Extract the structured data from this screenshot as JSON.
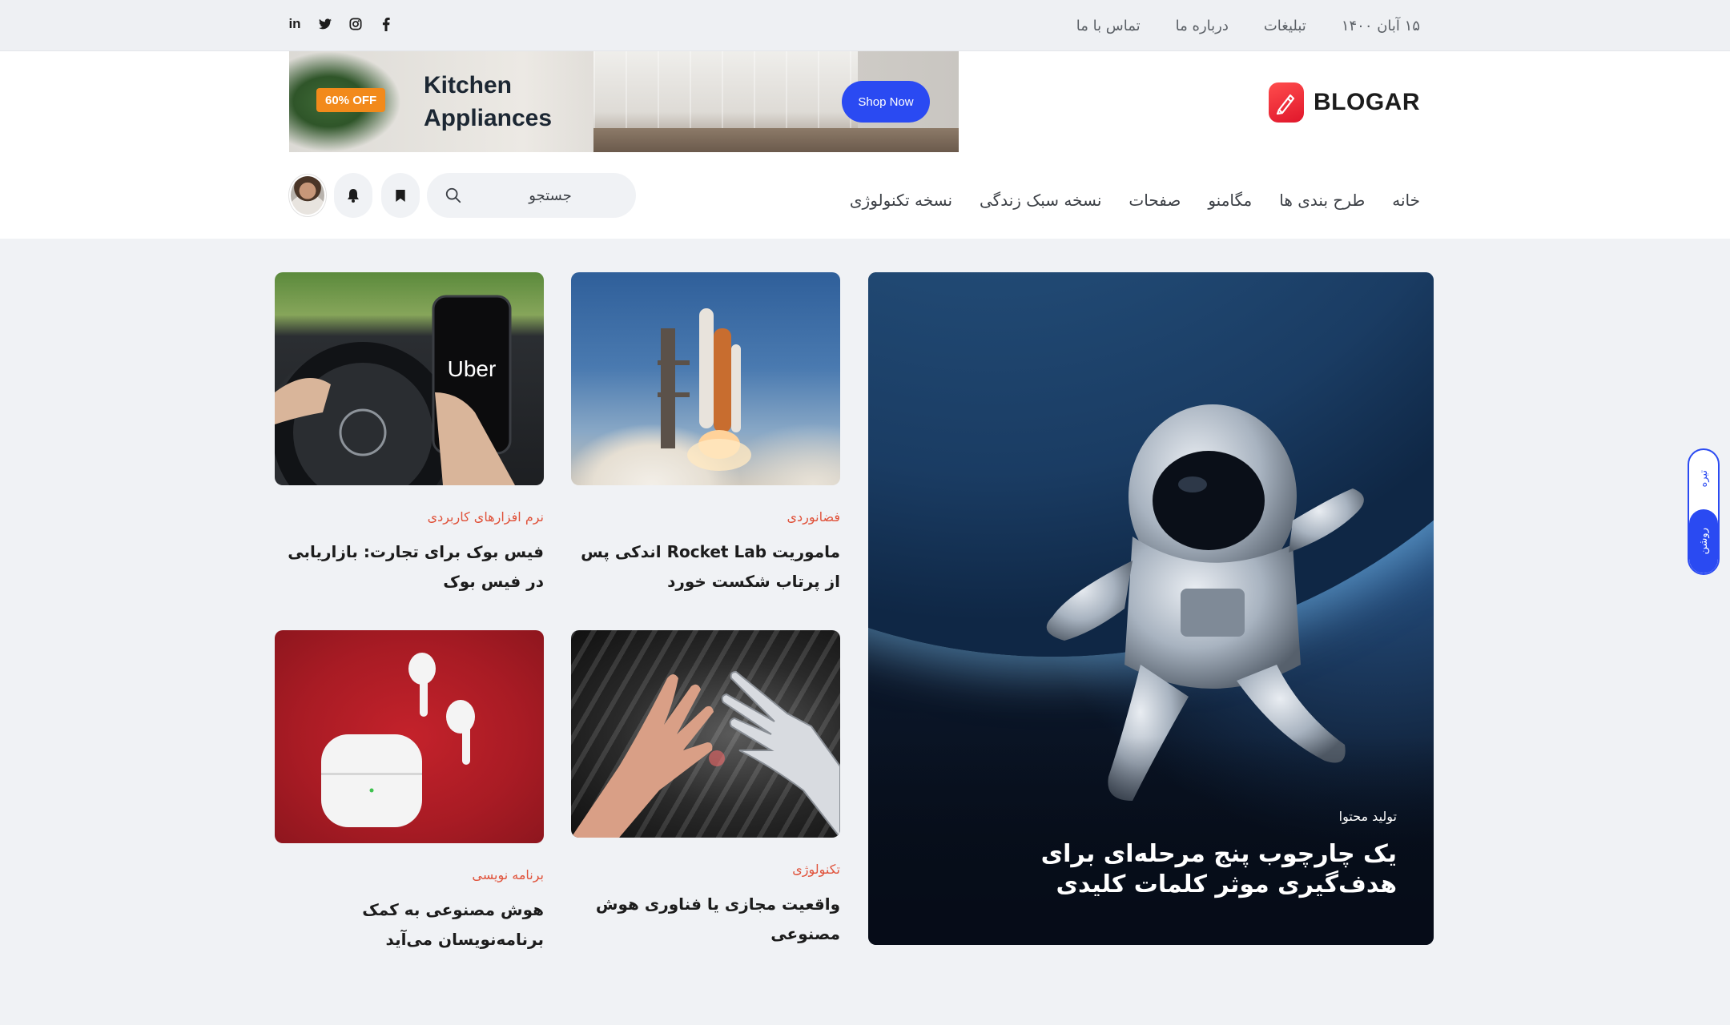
{
  "topbar": {
    "date": "۱۵ آبان ۱۴۰۰",
    "links": [
      "تبلیغات",
      "درباره ما",
      "تماس با ما"
    ],
    "social": [
      {
        "name": "facebook-icon",
        "glyph": "f"
      },
      {
        "name": "instagram-icon",
        "glyph": ""
      },
      {
        "name": "twitter-icon",
        "glyph": ""
      },
      {
        "name": "linkedin-icon",
        "glyph": "in"
      }
    ]
  },
  "header": {
    "logo_text": "BLOGAR",
    "banner": {
      "badge": "60% OFF",
      "title": "Kitchen Appliances",
      "button": "Shop Now"
    },
    "nav": [
      "خانه",
      "طرح بندی ها",
      "مگامنو",
      "صفحات",
      "نسخه سبک زندگی",
      "نسخه تکنولوژی"
    ],
    "search": {
      "placeholder": "جستجو"
    }
  },
  "hero": {
    "category": "تولید محتوا",
    "title": "یک چارچوب پنج مرحله‌ای برای هدف‌گیری موثر کلمات کلیدی"
  },
  "cards": [
    {
      "category": "فضانوردی",
      "title": "ماموریت Rocket Lab اندکی پس از پرتاب شکست خورد"
    },
    {
      "category": "نرم افزارهای کاربردی",
      "title": "فیس بوک برای تجارت: بازاریابی در فیس بوک"
    },
    {
      "category": "تکنولوژی",
      "title": "واقعیت مجازی یا فناوری هوش مصنوعی"
    },
    {
      "category": "برنامه نویسی",
      "title": "هوش مصنوعی به کمک برنامه‌نویسان می‌آید"
    }
  ],
  "theme_toggle": {
    "dark": "تیره",
    "light": "روشن"
  },
  "colors": {
    "accent": "#2a4af2",
    "category": "#e0523a",
    "brand": "#e0162b",
    "badge": "#f28a1b"
  }
}
